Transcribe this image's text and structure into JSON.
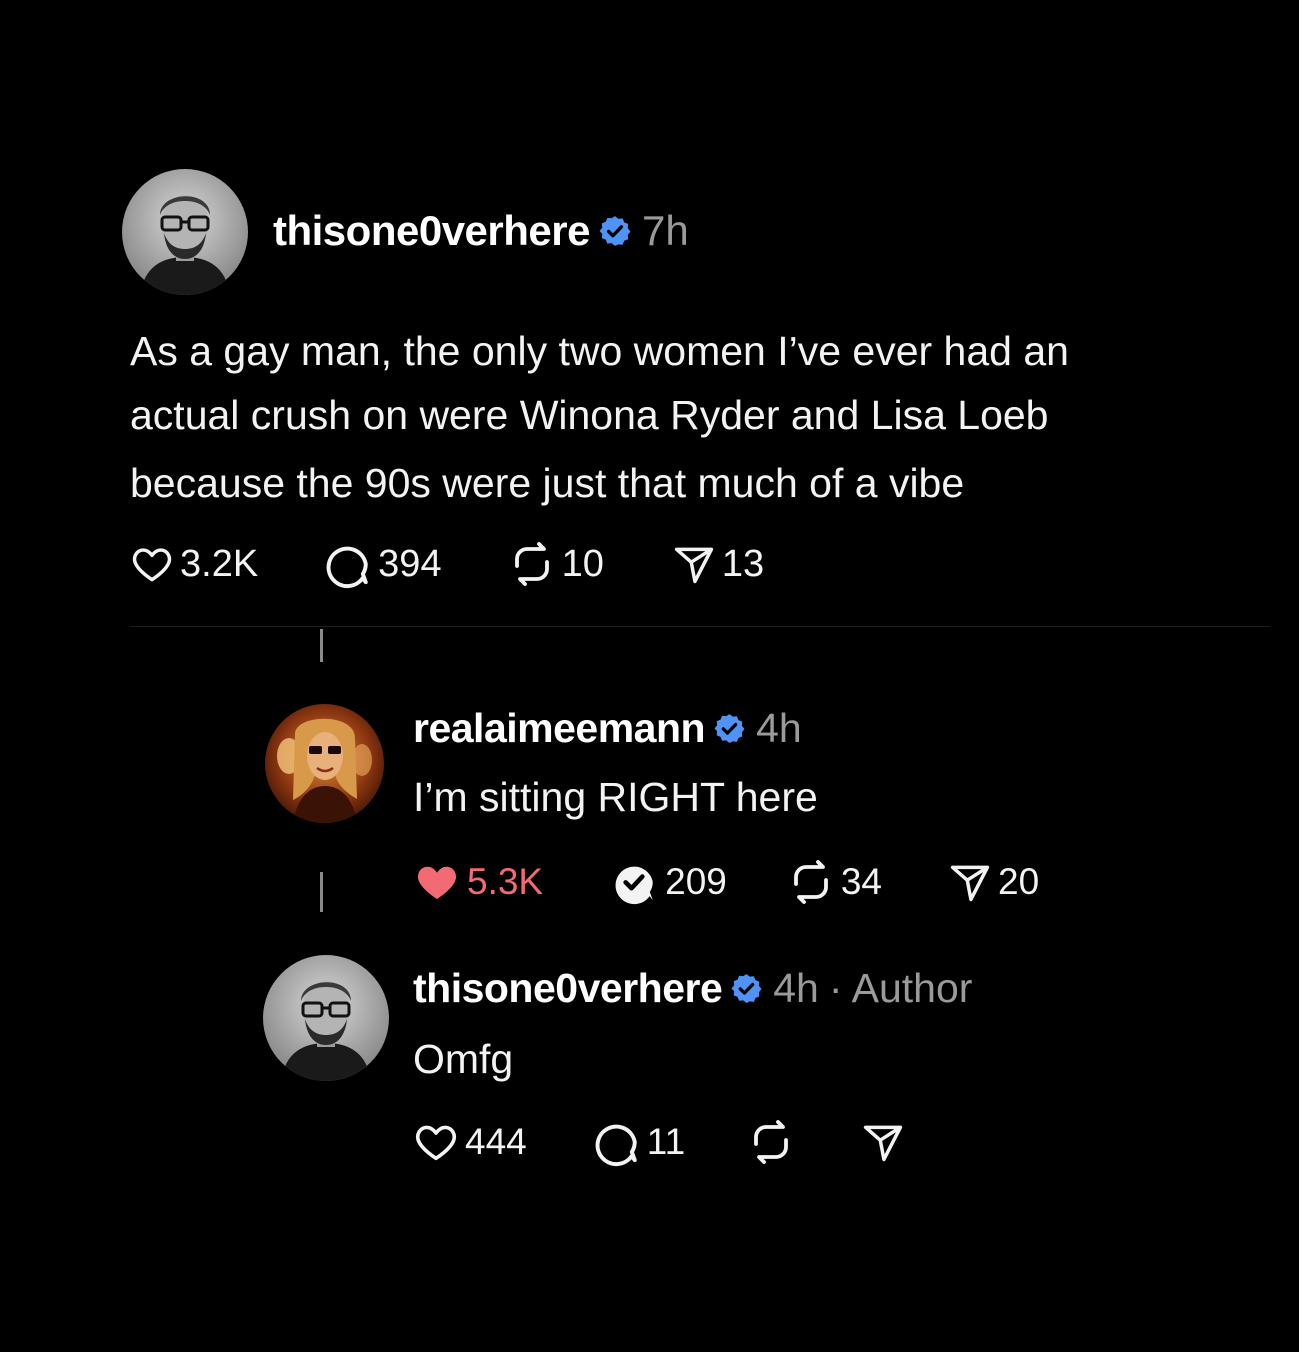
{
  "post": {
    "username": "thisone0verhere",
    "verified_icon": "verified-badge-icon",
    "time": "7h",
    "text_lines": [
      "As a gay man, the only two women I’ve ever had an",
      "actual crush on were Winona Ryder and Lisa Loeb",
      "because the 90s were just that much of a vibe"
    ],
    "likes": "3.2K",
    "comments": "394",
    "reposts": "10",
    "shares": "13"
  },
  "reply1": {
    "username": "realaimeemann",
    "time": "4h",
    "text": "I’m sitting RIGHT here",
    "likes": "5.3K",
    "liked": true,
    "comments": "209",
    "reposts": "34",
    "shares": "20"
  },
  "reply2": {
    "username": "thisone0verhere",
    "time": "4h",
    "author_tag": "· Author",
    "text": "Omfg",
    "likes": "444",
    "comments": "11"
  },
  "colors": {
    "background": "#000000",
    "text": "#f3f3f3",
    "muted": "#9a9a9a",
    "verified": "#4f93f5",
    "liked_heart": "#f26a74"
  }
}
